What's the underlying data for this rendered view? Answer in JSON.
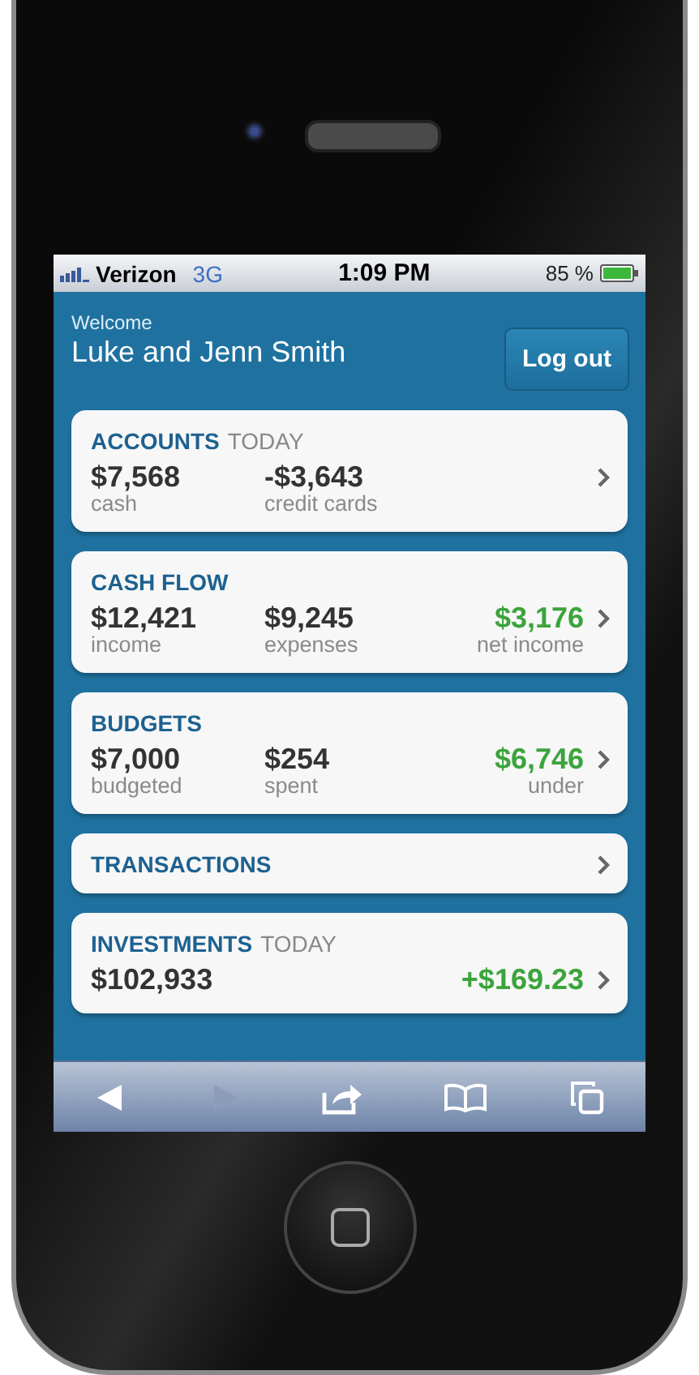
{
  "status_bar": {
    "carrier": "Verizon",
    "network": "3G",
    "time": "1:09 PM",
    "battery": "85 %"
  },
  "header": {
    "welcome": "Welcome",
    "name": "Luke and Jenn Smith",
    "logout_button": "Log out"
  },
  "cards": [
    {
      "title": "ACCOUNTS",
      "subtitle": "TODAY",
      "values": [
        {
          "kind": "plain",
          "amount": "$7,568",
          "label": "cash"
        },
        {
          "kind": "plain",
          "amount": "-$3,643",
          "label": "credit cards"
        }
      ]
    },
    {
      "title": "CASH FLOW",
      "values": [
        {
          "kind": "plain",
          "amount": "$12,421",
          "label": "income"
        },
        {
          "kind": "plain",
          "amount": "$9,245",
          "label": "expenses"
        },
        {
          "kind": "gain",
          "amount": "$3,176",
          "label": "net income"
        }
      ]
    },
    {
      "title": "BUDGETS",
      "values": [
        {
          "kind": "plain",
          "amount": "$7,000",
          "label": "budgeted"
        },
        {
          "kind": "plain",
          "amount": "$254",
          "label": "spent"
        },
        {
          "kind": "gain",
          "amount": "$6,746",
          "label": "under"
        }
      ]
    },
    {
      "title": "TRANSACTIONS"
    },
    {
      "title": "INVESTMENTS",
      "subtitle": "TODAY",
      "values": [
        {
          "kind": "plain",
          "amount": "$102,933"
        },
        {
          "kind": "gain",
          "amount": "+$169.23"
        }
      ]
    }
  ],
  "toolbar": [
    {
      "kind": "back",
      "disabled": false
    },
    {
      "kind": "forward",
      "disabled": true
    },
    {
      "kind": "share",
      "disabled": false
    },
    {
      "kind": "bookmarks",
      "disabled": false
    },
    {
      "kind": "pages",
      "disabled": false
    }
  ]
}
